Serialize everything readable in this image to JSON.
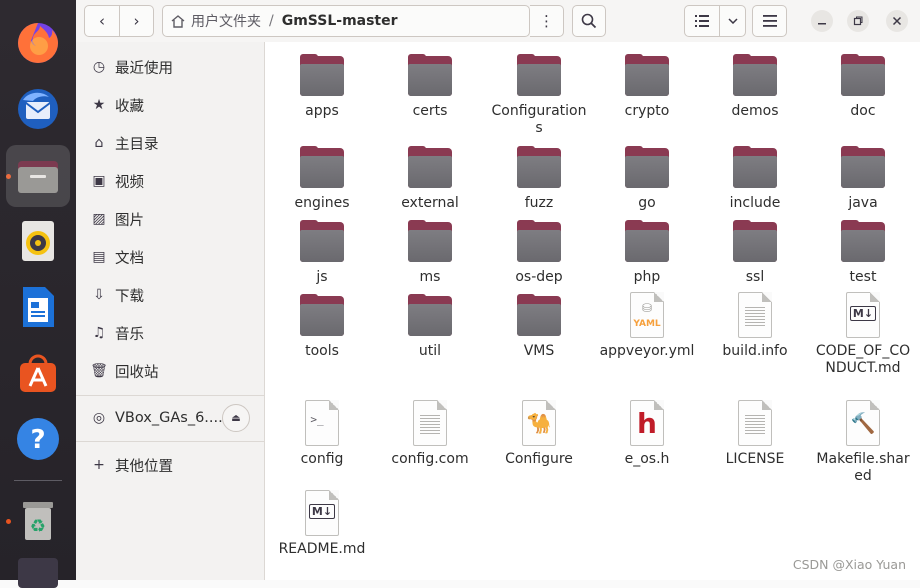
{
  "header": {
    "back_icon": "‹",
    "forward_icon": "›",
    "path_home": "用户文件夹",
    "path_sep": "/",
    "path_current": "GmSSL-master",
    "menu_dots": "⋮"
  },
  "sidebar": {
    "items": [
      {
        "icon": "clock-icon",
        "glyph": "◷",
        "label": "最近使用"
      },
      {
        "icon": "star-icon",
        "glyph": "★",
        "label": "收藏"
      },
      {
        "icon": "home-icon",
        "glyph": "⌂",
        "label": "主目录"
      },
      {
        "icon": "video-icon",
        "glyph": "▣",
        "label": "视频"
      },
      {
        "icon": "image-icon",
        "glyph": "▨",
        "label": "图片"
      },
      {
        "icon": "document-icon",
        "glyph": "▤",
        "label": "文档"
      },
      {
        "icon": "download-icon",
        "glyph": "⇩",
        "label": "下载"
      },
      {
        "icon": "music-icon",
        "glyph": "♫",
        "label": "音乐"
      },
      {
        "icon": "trash-icon",
        "glyph": "🗑",
        "label": "回收站"
      }
    ],
    "device": {
      "label": "VBox_GAs_6....",
      "eject": "⏏"
    },
    "other": {
      "glyph": "+",
      "label": "其他位置"
    }
  },
  "files": [
    {
      "label": "apps",
      "type": "folder"
    },
    {
      "label": "certs",
      "type": "folder"
    },
    {
      "label": "Configurations",
      "type": "folder"
    },
    {
      "label": "crypto",
      "type": "folder"
    },
    {
      "label": "demos",
      "type": "folder"
    },
    {
      "label": "doc",
      "type": "folder"
    },
    {
      "label": "engines",
      "type": "folder"
    },
    {
      "label": "external",
      "type": "folder"
    },
    {
      "label": "fuzz",
      "type": "folder"
    },
    {
      "label": "go",
      "type": "folder"
    },
    {
      "label": "include",
      "type": "folder"
    },
    {
      "label": "java",
      "type": "folder"
    },
    {
      "label": "js",
      "type": "folder"
    },
    {
      "label": "ms",
      "type": "folder"
    },
    {
      "label": "os-dep",
      "type": "folder"
    },
    {
      "label": "php",
      "type": "folder"
    },
    {
      "label": "ssl",
      "type": "folder"
    },
    {
      "label": "test",
      "type": "folder"
    },
    {
      "label": "tools",
      "type": "folder"
    },
    {
      "label": "util",
      "type": "folder"
    },
    {
      "label": "VMS",
      "type": "folder"
    },
    {
      "label": "appveyor.yml",
      "type": "yaml",
      "glyph": "YAML"
    },
    {
      "label": "build.info",
      "type": "text"
    },
    {
      "label": "CODE_OF_CONDUCT.md",
      "type": "md",
      "glyph": "M↓"
    },
    {
      "label": "config",
      "type": "script",
      "glyph": ">_"
    },
    {
      "label": "config.com",
      "type": "text"
    },
    {
      "label": "Configure",
      "type": "perl",
      "glyph": "🐪"
    },
    {
      "label": "e_os.h",
      "type": "header",
      "glyph": "h"
    },
    {
      "label": "LICENSE",
      "type": "text"
    },
    {
      "label": "Makefile.shared",
      "type": "make",
      "glyph": "🔨"
    },
    {
      "label": "README.md",
      "type": "md",
      "glyph": "M↓"
    }
  ],
  "watermark": "CSDN @Xiao Yuan",
  "colors": {
    "accent": "#e95420",
    "folder_tab": "#8a3a52",
    "folder_body": "#77767b",
    "dock": "#2b2a33"
  }
}
